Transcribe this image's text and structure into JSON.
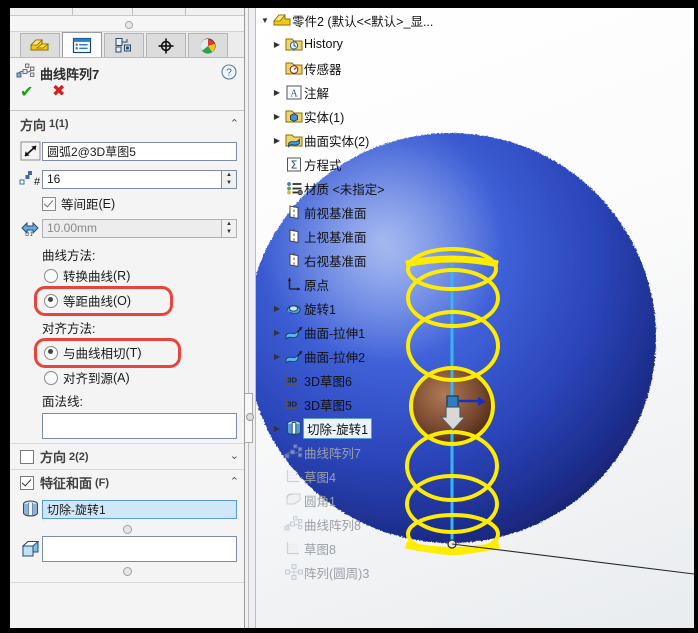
{
  "window": {
    "pane_splitter_icon": "splitter-dot"
  },
  "tabs": [
    {
      "name": "feature-manager-tab",
      "icon": "feature-tree-icon",
      "selected": false
    },
    {
      "name": "property-manager-tab",
      "icon": "property-list-icon",
      "selected": true
    },
    {
      "name": "configuration-manager-tab",
      "icon": "configuration-icon",
      "selected": false
    },
    {
      "name": "dimxpert-manager-tab",
      "icon": "dimxpert-target-icon",
      "selected": false
    },
    {
      "name": "display-manager-tab",
      "icon": "display-ball-icon",
      "selected": false
    }
  ],
  "property_manager": {
    "title": "曲线阵列7",
    "icon": "curve-pattern-icon",
    "help_icon": "help-question-icon",
    "ok_glyph": "✔",
    "cancel_glyph": "✖",
    "direction1": {
      "section_label": "方向",
      "section_suffix": "1(1)",
      "chevron": "⌃",
      "curve_icon": "direction-arrow-icon",
      "curve_value": "圆弧2@3D草图5",
      "count_icon": "instance-count-icon",
      "count_value": "16",
      "equal_spacing": {
        "label": "等间距",
        "mnemonic": "(E)",
        "checked": true
      },
      "spacing_icon": "spacing-d1-icon",
      "spacing_value": "10.00mm",
      "spacing_enabled": false,
      "curve_method_label": "曲线方法:",
      "curve_method_options": [
        {
          "label": "转换曲线",
          "mnemonic": "(R)",
          "selected": false
        },
        {
          "label": "等距曲线",
          "mnemonic": "(O)",
          "selected": true,
          "highlighted": true
        }
      ],
      "align_method_label": "对齐方法:",
      "align_method_options": [
        {
          "label": "与曲线相切",
          "mnemonic": "(T)",
          "selected": true,
          "highlighted": true
        },
        {
          "label": "对齐到源",
          "mnemonic": "(A)",
          "selected": false
        }
      ],
      "face_normal_label": "面法线:",
      "face_normal_value": ""
    },
    "direction2": {
      "section_label": "方向",
      "section_suffix": "2(2)",
      "checked": false,
      "chevron": "⌄"
    },
    "features_faces": {
      "section_label": "特征和面",
      "section_suffix": "(F)",
      "checked": true,
      "chevron": "⌃",
      "feature_icon": "cut-revolve-icon",
      "feature_value": "切除-旋转1",
      "face_icon": "face-cube-icon",
      "face_value": "",
      "handle_icon": "resize-handle-dot"
    },
    "highlight_color": "#e8443c"
  },
  "feature_tree": {
    "nodes": [
      {
        "label": "零件2  (默认<<默认>_显...",
        "icon": "part-icon",
        "indent": 0,
        "arrow": "expanded",
        "dim": false,
        "selected": false
      },
      {
        "label": "History",
        "icon": "history-folder-icon",
        "indent": 1,
        "arrow": "collapsed",
        "dim": false,
        "selected": false
      },
      {
        "label": "传感器",
        "icon": "sensor-folder-icon",
        "indent": 1,
        "arrow": "none",
        "dim": false,
        "selected": false
      },
      {
        "label": "注解",
        "icon": "annotations-folder-icon",
        "indent": 1,
        "arrow": "collapsed",
        "dim": false,
        "selected": false
      },
      {
        "label": "实体(1)",
        "icon": "solid-bodies-folder-icon",
        "indent": 1,
        "arrow": "collapsed",
        "dim": false,
        "selected": false
      },
      {
        "label": "曲面实体(2)",
        "icon": "surface-bodies-folder-icon",
        "indent": 1,
        "arrow": "collapsed",
        "dim": false,
        "selected": false
      },
      {
        "label": "方程式",
        "icon": "equations-icon",
        "indent": 1,
        "arrow": "none",
        "dim": false,
        "selected": false
      },
      {
        "label": "材质 <未指定>",
        "icon": "material-icon",
        "indent": 1,
        "arrow": "none",
        "dim": false,
        "selected": false
      },
      {
        "label": "前视基准面",
        "icon": "plane-icon",
        "indent": 1,
        "arrow": "none",
        "dim": false,
        "selected": false
      },
      {
        "label": "上视基准面",
        "icon": "plane-icon",
        "indent": 1,
        "arrow": "none",
        "dim": false,
        "selected": false
      },
      {
        "label": "右视基准面",
        "icon": "plane-icon",
        "indent": 1,
        "arrow": "none",
        "dim": false,
        "selected": false
      },
      {
        "label": "原点",
        "icon": "origin-icon",
        "indent": 1,
        "arrow": "none",
        "dim": false,
        "selected": false
      },
      {
        "label": "旋转1",
        "icon": "revolve-icon",
        "indent": 1,
        "arrow": "collapsed",
        "dim": false,
        "selected": false
      },
      {
        "label": "曲面-拉伸1",
        "icon": "surface-extrude-icon",
        "indent": 1,
        "arrow": "collapsed",
        "dim": false,
        "selected": false
      },
      {
        "label": "曲面-拉伸2",
        "icon": "surface-extrude-icon",
        "indent": 1,
        "arrow": "collapsed",
        "dim": false,
        "selected": false
      },
      {
        "label": "3D草图6",
        "icon": "sketch3d-icon",
        "indent": 1,
        "arrow": "none",
        "dim": false,
        "selected": false
      },
      {
        "label": "3D草图5",
        "icon": "sketch3d-icon",
        "indent": 1,
        "arrow": "none",
        "dim": false,
        "selected": false
      },
      {
        "label": "切除-旋转1",
        "icon": "cut-revolve-icon",
        "indent": 1,
        "arrow": "collapsed",
        "dim": false,
        "selected": true
      },
      {
        "label": "曲线阵列7",
        "icon": "curve-pattern-icon",
        "indent": 1,
        "arrow": "none",
        "dim": true,
        "selected": false
      },
      {
        "label": "草图4",
        "icon": "sketch-icon",
        "indent": 1,
        "arrow": "none",
        "dim": true,
        "selected": false
      },
      {
        "label": "圆角1",
        "icon": "fillet-icon",
        "indent": 1,
        "arrow": "none",
        "dim": true,
        "selected": false
      },
      {
        "label": "曲线阵列8",
        "icon": "curve-pattern-icon",
        "indent": 1,
        "arrow": "none",
        "dim": true,
        "selected": false
      },
      {
        "label": "草图8",
        "icon": "sketch-icon",
        "indent": 1,
        "arrow": "none",
        "dim": true,
        "selected": false
      },
      {
        "label": "阵列(圆周)3",
        "icon": "circular-pattern-icon",
        "indent": 1,
        "arrow": "none",
        "dim": true,
        "selected": false
      }
    ]
  },
  "viewport": {
    "model_name": "sphere-model",
    "body_color": "#2646c8",
    "pattern_curve_color": "#ffec00",
    "axis_color": "#35b6ef",
    "pattern_instance_count": 7,
    "callout_line": "leader-line"
  }
}
